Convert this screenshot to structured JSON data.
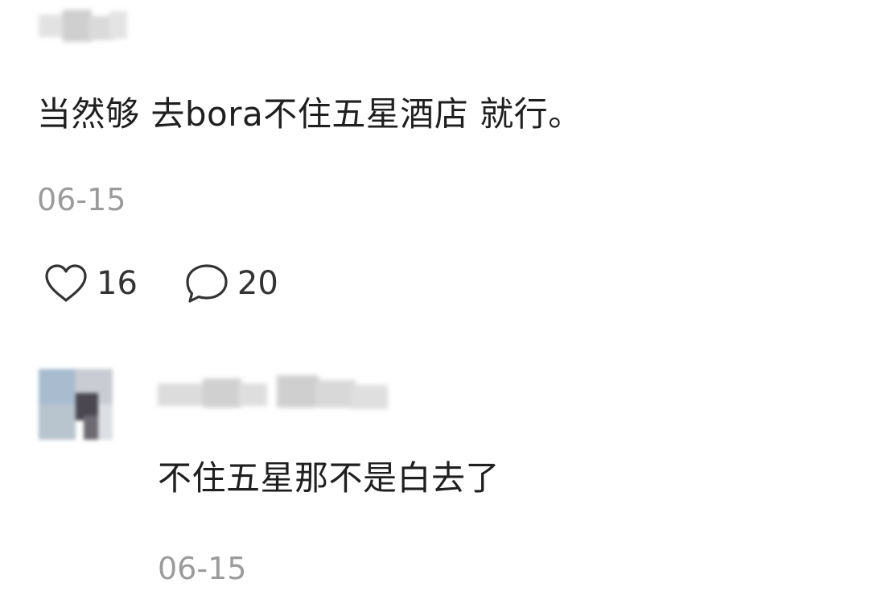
{
  "comment": {
    "text": "当然够 去bora不住五星酒店 就行。",
    "date": "06-15",
    "likes": "16",
    "replies": "20",
    "like_icon": "heart-outline-icon",
    "reply_icon": "speech-bubble-outline-icon"
  },
  "reply": {
    "text": "不住五星那不是白去了",
    "date": "06-15"
  }
}
